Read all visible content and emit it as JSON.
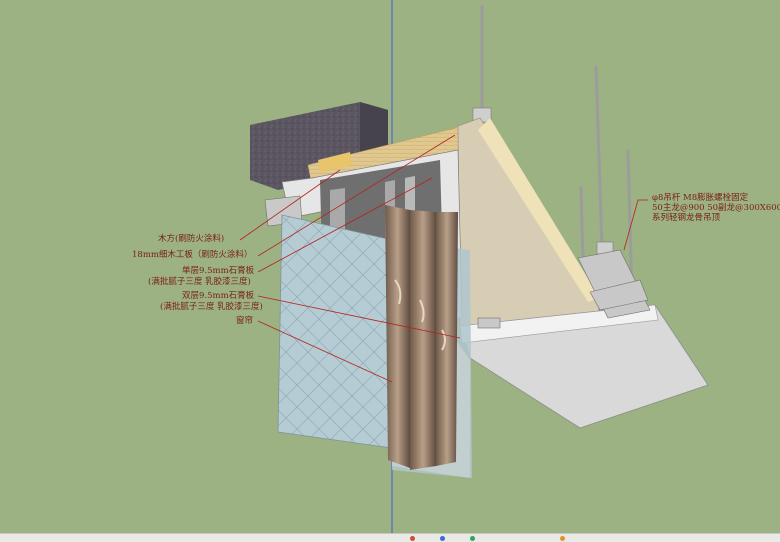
{
  "labels": {
    "wood_block": "木方(刷防火涂料)",
    "plywood": "18mm细木工板（刷防火涂料）",
    "gypsum_single_1": "单层9.5mm石膏板",
    "gypsum_single_2": "(满批腻子三度 乳胶漆三度)",
    "gypsum_double_1": "双层9.5mm石膏板",
    "gypsum_double_2": "(满批腻子三度 乳胶漆三度)",
    "curtain_box": "窗帘",
    "rod_1": "φ8吊杆 M8膨胀螺栓固定",
    "rod_2": "50主龙@900  50副龙@300X600",
    "rod_3": "系列轻钢龙骨吊顶"
  },
  "colors": {
    "background": "#9cb282",
    "guide_axis": "#3b5bd6",
    "leader": "#b2231e",
    "label_text": "#7a1f14",
    "concrete": "#5b5660",
    "plywood": "#e3cf9b",
    "gypsum": "#e8e8e8",
    "glass": "#b9d0d6"
  },
  "icons": [
    "taskbar-dot-red",
    "taskbar-dot-blue",
    "taskbar-dot-green",
    "taskbar-dot-orange"
  ]
}
